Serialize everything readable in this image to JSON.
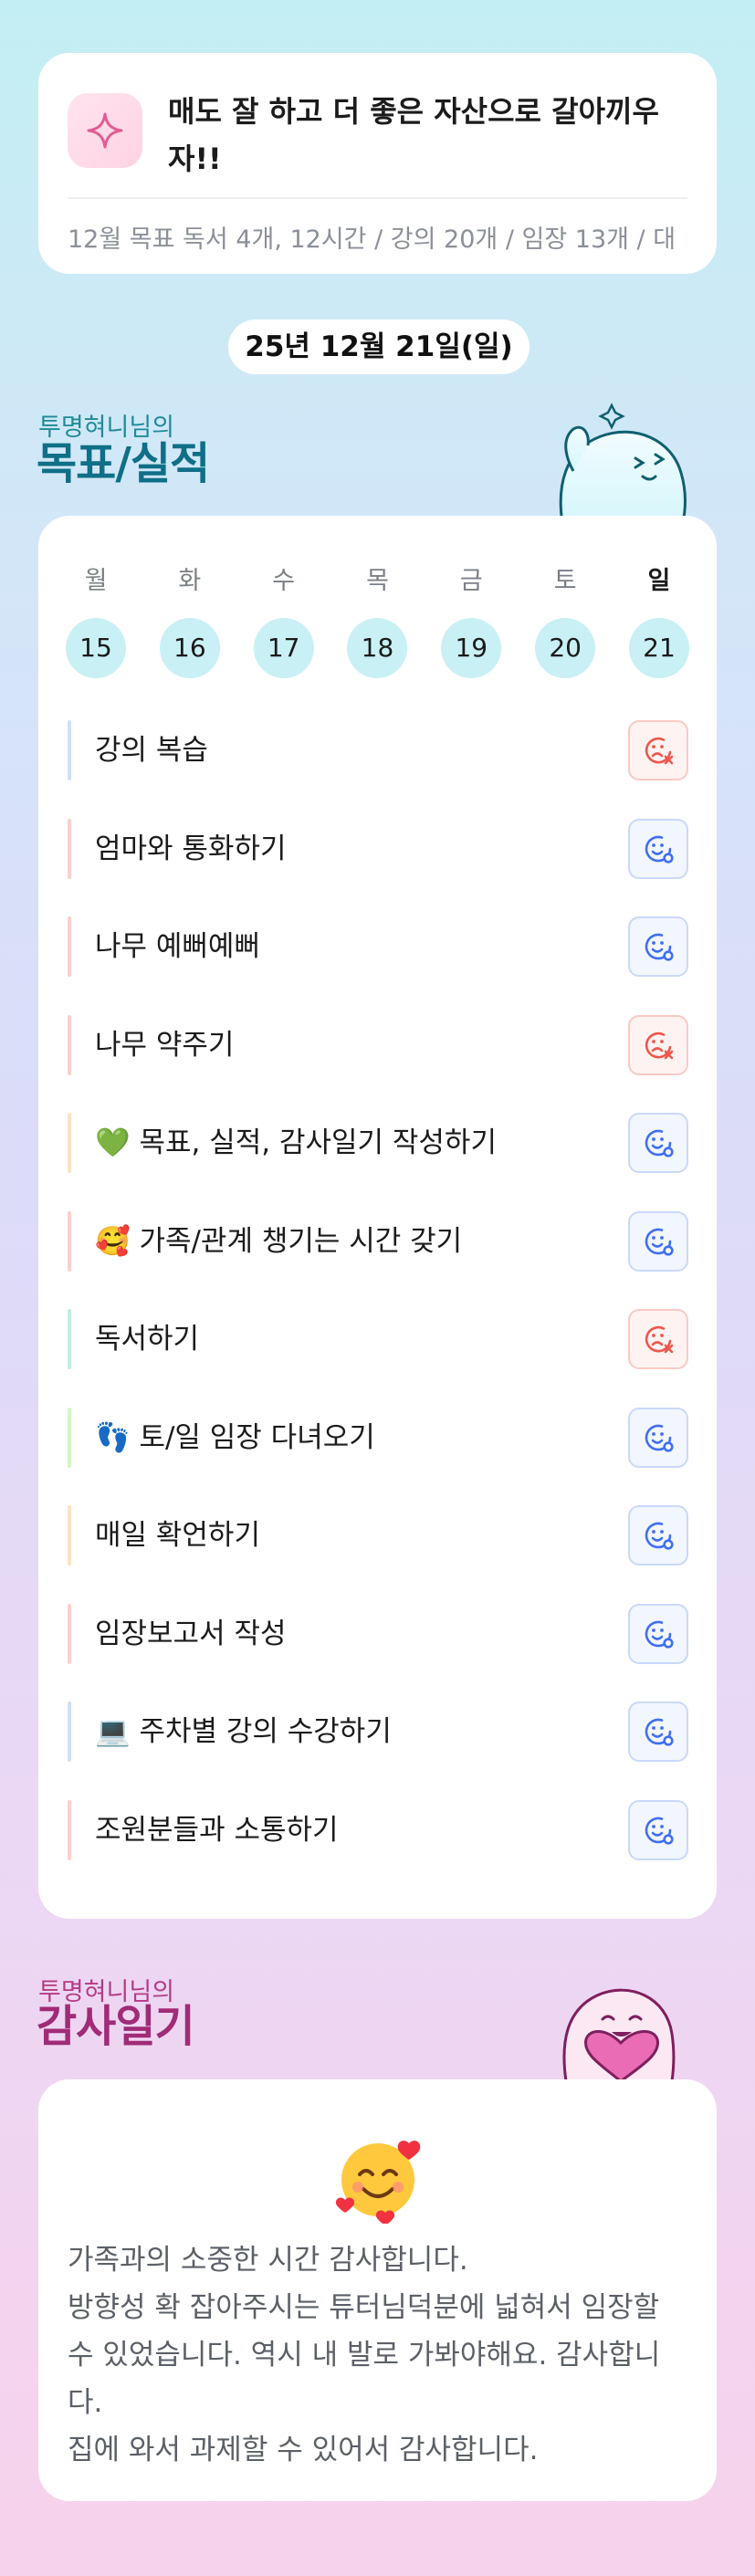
{
  "goal": {
    "title": "매도 잘 하고 더 좋은 자산으로 갈아끼우자!!",
    "subtitle": "12월 목표  독서 4개, 12시간 / 강의 20개 / 임장 13개 / 대"
  },
  "date_label": "25년 12월 21일(일)",
  "goals_section": {
    "owner_label": "투명혀니님의",
    "title": "목표/실적"
  },
  "week": [
    {
      "label": "월",
      "num": "15"
    },
    {
      "label": "화",
      "num": "16"
    },
    {
      "label": "수",
      "num": "17"
    },
    {
      "label": "목",
      "num": "18"
    },
    {
      "label": "금",
      "num": "19"
    },
    {
      "label": "토",
      "num": "20"
    },
    {
      "label": "일",
      "num": "21"
    }
  ],
  "tasks": [
    {
      "text": "강의 복습",
      "status": "fail",
      "bar_color": "#cfe0f7"
    },
    {
      "text": "엄마와 통화하기",
      "status": "done",
      "bar_color": "#fcd0cf"
    },
    {
      "text": "나무 예뻐예뻐",
      "status": "done",
      "bar_color": "#fcd0cf"
    },
    {
      "text": "나무 약주기",
      "status": "fail",
      "bar_color": "#fcd0cf"
    },
    {
      "text": "💚 목표, 실적, 감사일기 작성하기",
      "status": "done",
      "bar_color": "#fbe3c2"
    },
    {
      "text": "🥰 가족/관계 챙기는 시간 갖기",
      "status": "done",
      "bar_color": "#fcd0cf"
    },
    {
      "text": "독서하기",
      "status": "fail",
      "bar_color": "#bdf0df"
    },
    {
      "text": "👣 토/일 임장 다녀오기",
      "status": "done",
      "bar_color": "#d5f5c8"
    },
    {
      "text": "매일 확언하기",
      "status": "done",
      "bar_color": "#fbe3c2"
    },
    {
      "text": "임장보고서 작성",
      "status": "done",
      "bar_color": "#fcd0cf"
    },
    {
      "text": "💻 주차별 강의 수강하기",
      "status": "done",
      "bar_color": "#cfe0f7"
    },
    {
      "text": "조원분들과 소통하기",
      "status": "done",
      "bar_color": "#fcd0cf"
    }
  ],
  "gratitude_section": {
    "owner_label": "투명혀니님의",
    "title": "감사일기"
  },
  "gratitude": {
    "emoji": "🥰",
    "lines": [
      "가족과의 소중한 시간 감사합니다.",
      "방향성 확 잡아주시는 튜터님덕분에 넓혀서 임장할 수 있었습니다. 역시 내 발로 가봐야해요. 감사합니다.",
      "집에 와서 과제할 수 있어서 감사합니다."
    ]
  },
  "colors": {
    "teal_title": "#0f6f86",
    "pink_title": "#a02b77",
    "done_icon": "#3f6ff2",
    "fail_icon": "#f0564b",
    "day_circle": "#c9f0f5"
  }
}
